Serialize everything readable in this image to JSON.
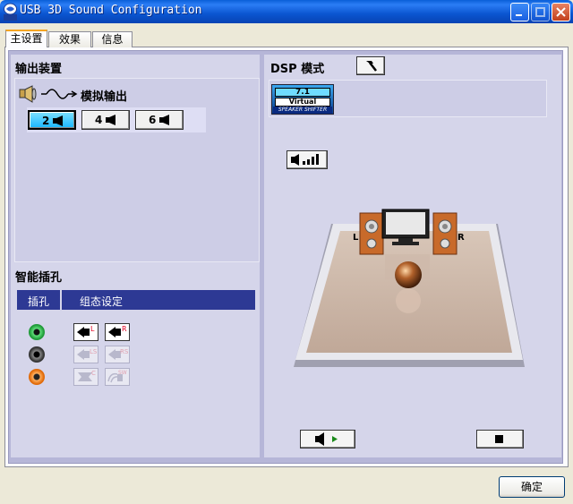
{
  "window": {
    "title": "USB 3D Sound Configuration",
    "app_icon_label": "USB"
  },
  "tabs": [
    {
      "label": "主设置",
      "active": true
    },
    {
      "label": "效果",
      "active": false
    },
    {
      "label": "信息",
      "active": false
    }
  ],
  "output_device": {
    "section_title": "输出装置",
    "mode_label": "模拟输出",
    "speaker_buttons": [
      {
        "label": "2",
        "selected": true
      },
      {
        "label": "4",
        "selected": false
      },
      {
        "label": "6",
        "selected": false
      }
    ]
  },
  "smart_jack": {
    "section_title": "智能插孔",
    "columns": [
      "插孔",
      "组态设定"
    ],
    "jacks": [
      {
        "color": "#2db84a",
        "config": [
          "L",
          "R"
        ],
        "enabled": true
      },
      {
        "color": "#404040",
        "config": [
          "LS",
          "RS"
        ],
        "enabled": false
      },
      {
        "color": "#f07a10",
        "config": [
          "C",
          "SW"
        ],
        "enabled": false
      }
    ]
  },
  "dsp": {
    "section_title": "DSP 模式",
    "logo_top": "7.1",
    "logo_mid": "Virtual",
    "logo_bottom": "SPEAKER SHIFTER",
    "left_label": "L",
    "right_label": "R"
  },
  "footer": {
    "ok_label": "确定"
  },
  "colors": {
    "title_bar": "#0a55d0",
    "panel": "#d5d5ea",
    "jack_header": "#2d3994",
    "active_button": "#19b6ff"
  }
}
